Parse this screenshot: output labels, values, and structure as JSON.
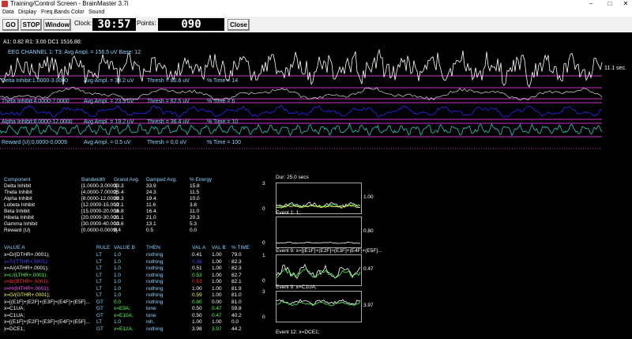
{
  "window": {
    "title": "Training/Control Screen - BrainMaster 3.7i"
  },
  "menu": [
    "Data",
    "Display",
    "Freq.Bands",
    "Color",
    "Sound"
  ],
  "toolbar": {
    "go_label": "GO",
    "stop_label": "STOP",
    "window_label": "Window",
    "clock_label": "Clock:",
    "clock_value": "30:57",
    "points_label": "Points:",
    "points_value": "090",
    "close_label": "Close"
  },
  "status_line": "A1: 0.82  R1: 3.00  DC1 1516.86:",
  "eeg": {
    "channel_label": "EEG CHANNEL 1: T3: Avg Ampl. = 156.5 uV  Base: 12",
    "time_scale": "11.1 sec.",
    "bands": [
      {
        "name": "Delta Inhibit:1.0000-3.0000",
        "avg": "Avg Ampl. = 33.2 uV",
        "thresh": "Thresh = 80.6 uV",
        "pct": "% Time = 14"
      },
      {
        "name": "Theta Inhibit:4.0000-7.0000",
        "avg": "Avg Ampl. = 23.9 uV",
        "thresh": "Thresh = 62.5 uV",
        "pct": "% Time = 6"
      },
      {
        "name": "Alpha Inhibit:8.0000-12.0000",
        "avg": "Avg Ampl. = 19.2 uV",
        "thresh": "Thresh = 36.4 uV",
        "pct": "% Time = 10"
      },
      {
        "name": "Reward (U):0.0000-0.0009",
        "avg": "Avg Ampl. = 0.5 uV",
        "thresh": "Thresh = 0.0 uV",
        "pct": "% Time = 100"
      }
    ]
  },
  "components": {
    "headers": [
      "Component",
      "Bandwidth",
      "Grand Avg.",
      "Damped Avg.",
      "% Energy"
    ],
    "rows": [
      [
        "Delta Inhibit",
        "[1.0000-3.0000]",
        "33.3",
        "33.9",
        "15.8"
      ],
      [
        "Theta Inhibit",
        "[4.0000-7.0000]",
        "25.4",
        "24.3",
        "11.5"
      ],
      [
        "Alpha Inhibit",
        "[8.0000-12.0000",
        "20.3",
        "19.4",
        "10.0"
      ],
      [
        "Lobeta Inhibit",
        "[12.0000-15.000",
        "12.1",
        "11.6",
        "3.8"
      ],
      [
        "Beta Inhibit",
        "[15.0000-20.000",
        "16.8",
        "16.4",
        "11.0"
      ],
      [
        "Hibeta Inhibit",
        "[20.0000-30.000",
        "21.1",
        "21.0",
        "20.3"
      ],
      [
        "Gamma Inhibit",
        "[30.0000-40.000",
        "13.6",
        "13.1",
        "5.3"
      ],
      [
        "Reward (U)",
        "[0.0000-0.0009]",
        "0.4",
        "0.5",
        "0.0"
      ]
    ]
  },
  "events": {
    "headers": [
      "VALUE A",
      "RULE",
      "VALUE B",
      "THEN:",
      "VAL A",
      "VAL B",
      "% TIME"
    ],
    "rows": [
      {
        "a": "x=D/(DTHR+.0001);",
        "rule": "LT",
        "b": "1.0",
        "then": "nothing",
        "va": "0.41",
        "vb": "1.00",
        "pct": "79.0",
        "color": "#ffffff",
        "vacolor": "#ffffff"
      },
      {
        "a": "x=T/(TTHR+.0001);",
        "rule": "LT",
        "b": "1.0",
        "then": "nothing",
        "va": "0.38",
        "vb": "1.00",
        "pct": "82.3",
        "color": "#4a4aff",
        "vacolor": "#4a4aff"
      },
      {
        "a": "x=A/(ATHR+.0001);",
        "rule": "LT",
        "b": "1.0",
        "then": "nothing",
        "va": "0.51",
        "vb": "1.00",
        "pct": "82.3",
        "color": "#ffffff",
        "vacolor": "#ffffff"
      },
      {
        "a": "x=L/(LTHR+.0001);",
        "rule": "LT",
        "b": "1.0",
        "then": "nothing",
        "va": "0.53",
        "vb": "1.00",
        "pct": "82.7",
        "color": "#55ff55",
        "vacolor": "#55ff55"
      },
      {
        "a": "x=B/(BTHR+.0001);",
        "rule": "LT",
        "b": "1.0",
        "then": "nothing",
        "va": "0.53",
        "vb": "1.00",
        "pct": "82.1",
        "color": "#ff3333",
        "vacolor": "#ff3333"
      },
      {
        "a": "x=H/(HTHR+.0001);",
        "rule": "LT",
        "b": "1.0",
        "then": "nothing",
        "va": "1.00",
        "vb": "1.00",
        "pct": "81.9",
        "color": "#ff55ff",
        "vacolor": "#ffffff"
      },
      {
        "a": "x=G/(GTHR+.0001);",
        "rule": "LT",
        "b": "1.0",
        "then": "nothing",
        "va": "0.59",
        "vb": "1.00",
        "pct": "81.0",
        "color": "#ffff55",
        "vacolor": "#ffff55"
      },
      {
        "a": "x=[(E1F]+(E2F]+(E3F]+(E4F]+(E5F]...",
        "rule": "GT",
        "b": "0.0",
        "then": "nothing",
        "va": "0.80",
        "vb": "0.00",
        "pct": "81.0",
        "color": "#ffffff",
        "vacolor": "#55ff55"
      },
      {
        "a": "x=C1UA;",
        "rule": "GT",
        "b": "x=E9A;",
        "then": "tone",
        "va": "0.50",
        "vb": "0.47",
        "pct": "59.8",
        "color": "#ffffff",
        "vacolor": "#ffffff"
      },
      {
        "a": "x=C1UA;",
        "rule": "GT",
        "b": "x=E10A;",
        "then": "tone",
        "va": "0.50",
        "vb": "0.47",
        "pct": "40.2",
        "color": "#ffffff",
        "vacolor": "#ffffff"
      },
      {
        "a": "x=[(E1F]+(E2F]+(E3F]+(E4F]+(E5F]...",
        "rule": "LT",
        "b": "1.0",
        "then": "inh.",
        "va": "1.00",
        "vb": "1.00",
        "pct": "0.0",
        "color": "#ffffff",
        "vacolor": "#ffffff"
      },
      {
        "a": "x=DCE1;",
        "rule": "GT",
        "b": "x=E12A;",
        "then": "nothing",
        "va": "3.98",
        "vb": "3.97",
        "pct": "44.2",
        "color": "#ffffff",
        "vacolor": "#ffffff"
      }
    ]
  },
  "mini_charts": {
    "duration_label": "Dur: 25.0 secs",
    "charts": [
      {
        "event": "",
        "left_top": "3",
        "left_bottom": "0",
        "right": "1.00"
      },
      {
        "event": "Event 1: 1;",
        "left_top": "",
        "left_bottom": "0",
        "right": "0.80"
      },
      {
        "event": "Event 9: x=[(E1F]+(E2F]+(E3F]+(E4F]+(E5F]...",
        "left_top": "1",
        "left_bottom": "0",
        "right": "0.47"
      },
      {
        "event": "Event 9: x=C1UA;",
        "left_top": "3",
        "left_bottom": "0",
        "right": "3.97"
      }
    ],
    "last_event": "Event 12: x=DCE1;"
  },
  "colors": {
    "accent_blue": "#8fd3ff",
    "threshold": "#cc33cc",
    "wave_white": "#ffffff",
    "wave_blue": "#2222ff",
    "wave_cyan": "#22cccc"
  }
}
